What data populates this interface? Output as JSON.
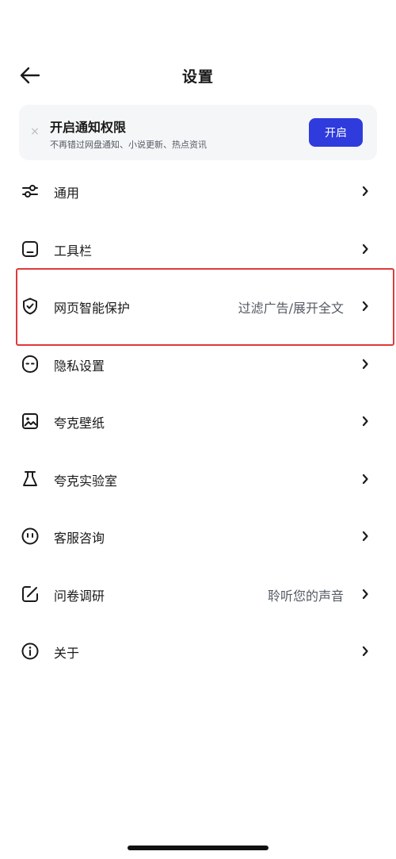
{
  "header": {
    "title": "设置",
    "back_icon": "arrow-left-icon"
  },
  "banner": {
    "title": "开启通知权限",
    "subtitle": "不再错过网盘通知、小说更新、热点资讯",
    "close_label": "×",
    "button_label": "开启",
    "accent_color": "#2f3bdc"
  },
  "settings": {
    "items": [
      {
        "label": "通用",
        "value": "",
        "icon": "sliders-icon"
      },
      {
        "label": "工具栏",
        "value": "",
        "icon": "toolbar-icon"
      },
      {
        "label": "网页智能保护",
        "value": "过滤广告/展开全文",
        "icon": "shield-check-icon"
      },
      {
        "label": "隐私设置",
        "value": "",
        "icon": "privacy-icon"
      },
      {
        "label": "夸克壁纸",
        "value": "",
        "icon": "wallpaper-icon"
      },
      {
        "label": "夸克实验室",
        "value": "",
        "icon": "flask-icon"
      },
      {
        "label": "客服咨询",
        "value": "",
        "icon": "support-icon"
      },
      {
        "label": "问卷调研",
        "value": "聆听您的声音",
        "icon": "edit-icon"
      },
      {
        "label": "关于",
        "value": "",
        "icon": "info-icon"
      }
    ]
  },
  "highlight_color": "#e03a3a"
}
